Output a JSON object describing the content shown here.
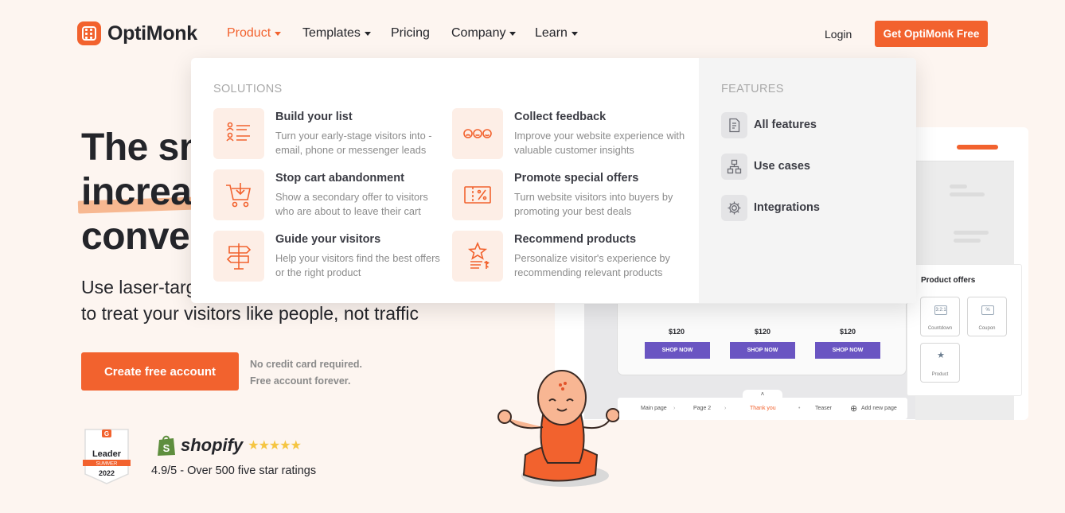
{
  "brand": {
    "name": "OptiMonk",
    "accent": "#f2622e"
  },
  "nav": {
    "items": [
      {
        "label": "Product",
        "has_caret": true,
        "active": true
      },
      {
        "label": "Templates",
        "has_caret": true
      },
      {
        "label": "Pricing",
        "has_caret": false
      },
      {
        "label": "Company",
        "has_caret": true
      },
      {
        "label": "Learn",
        "has_caret": true
      }
    ],
    "login": "Login",
    "cta": "Get OptiMonk Free"
  },
  "hero": {
    "title_line1": "The sm",
    "title_line2": "increas",
    "title_line3": "convers",
    "subtitle_line1": "Use laser-targ",
    "subtitle_line2": "to treat your visitors like people, not traffic",
    "cta": "Create free account",
    "note_line1": "No credit card required.",
    "note_line2": "Free account forever."
  },
  "social": {
    "badge": {
      "brand": "G",
      "title": "Leader",
      "season": "SUMMER",
      "year": "2022"
    },
    "shopify": "shopify",
    "stars": "★★★★★",
    "rating": "4.9/5 - Over 500 five star ratings"
  },
  "mock": {
    "prices": [
      "$120",
      "$120",
      "$120"
    ],
    "shop_now": "SHOP NOW",
    "pages": [
      "Main page",
      "Page 2",
      "Thank you",
      "Teaser",
      "Add new page"
    ],
    "offers_title": "Product offers",
    "offers": [
      {
        "label": "Countdown",
        "icon": "3:2:1"
      },
      {
        "label": "Coupon",
        "icon": "%"
      },
      {
        "label": "Product",
        "icon": "★"
      }
    ]
  },
  "dropdown": {
    "solutions_heading": "SOLUTIONS",
    "features_heading": "FEATURES",
    "solutions": [
      {
        "title": "Build your list",
        "desc": "Turn your early-stage visitors into - email, phone or messenger leads",
        "icon": "list-icon"
      },
      {
        "title": "Collect feedback",
        "desc": "Improve your website experience with valuable customer insights",
        "icon": "feedback-icon"
      },
      {
        "title": "Stop cart abandonment",
        "desc": "Show a secondary offer to visitors who are about to leave their cart",
        "icon": "cart-icon"
      },
      {
        "title": "Promote special offers",
        "desc": "Turn website visitors into buyers by promoting your best deals",
        "icon": "coupon-icon"
      },
      {
        "title": "Guide your visitors",
        "desc": "Help your visitors find the best offers or the right product",
        "icon": "signpost-icon"
      },
      {
        "title": "Recommend products",
        "desc": "Personalize visitor's experience by recommending relevant products",
        "icon": "recommend-icon"
      }
    ],
    "features": [
      {
        "label": "All features",
        "icon": "document-icon"
      },
      {
        "label": "Use cases",
        "icon": "sitemap-icon"
      },
      {
        "label": "Integrations",
        "icon": "gear-icon"
      }
    ]
  }
}
